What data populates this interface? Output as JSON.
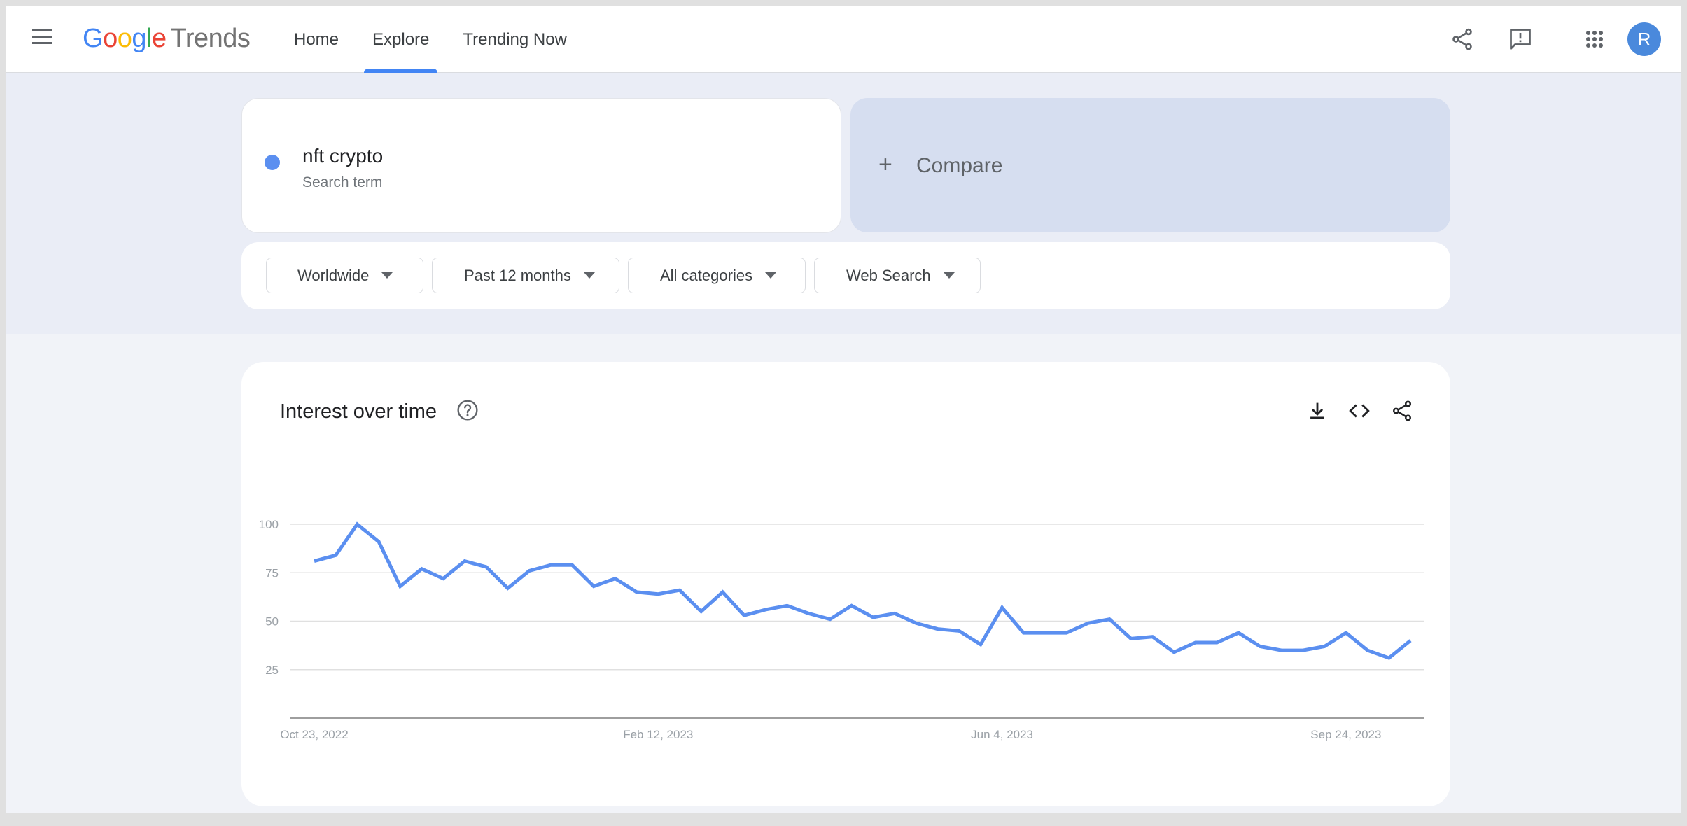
{
  "header": {
    "menu_icon": "hamburger-menu-icon",
    "logo": {
      "google": [
        "G",
        "o",
        "o",
        "g",
        "l",
        "e"
      ],
      "product": "Trends"
    },
    "nav": [
      {
        "label": "Home",
        "active": false
      },
      {
        "label": "Explore",
        "active": true
      },
      {
        "label": "Trending Now",
        "active": false
      }
    ],
    "icons": [
      "share-icon",
      "feedback-icon",
      "apps-grid-icon"
    ],
    "avatar_initial": "R",
    "accent_color": "#4285f4"
  },
  "search": {
    "term": "nft crypto",
    "term_subtitle": "Search term",
    "term_color": "#5b8ff0",
    "compare_label": "Compare",
    "compare_icon": "plus-icon"
  },
  "filters": [
    {
      "label": "Worldwide"
    },
    {
      "label": "Past 12 months"
    },
    {
      "label": "All categories"
    },
    {
      "label": "Web Search"
    }
  ],
  "chart_card": {
    "title": "Interest over time",
    "icons": [
      "help-icon",
      "download-icon",
      "embed-code-icon",
      "share-icon"
    ]
  },
  "chart_data": {
    "type": "line",
    "title": "Interest over time",
    "xlabel": "",
    "ylabel": "",
    "ylim": [
      0,
      100
    ],
    "yticks": [
      25,
      50,
      75,
      100
    ],
    "x_tick_labels": [
      {
        "index": 0,
        "label": "Oct 23, 2022"
      },
      {
        "index": 16,
        "label": "Feb 12, 2023"
      },
      {
        "index": 32,
        "label": "Jun 4, 2023"
      },
      {
        "index": 48,
        "label": "Sep 24, 2023"
      }
    ],
    "grid": true,
    "series": [
      {
        "name": "nft crypto",
        "color": "#5b8ff0",
        "values": [
          81,
          84,
          100,
          91,
          68,
          77,
          72,
          81,
          78,
          67,
          76,
          79,
          79,
          68,
          72,
          65,
          64,
          66,
          55,
          65,
          53,
          56,
          58,
          54,
          51,
          58,
          52,
          54,
          49,
          46,
          45,
          38,
          57,
          44,
          44,
          44,
          49,
          51,
          41,
          42,
          34,
          39,
          39,
          44,
          37,
          35,
          35,
          37,
          44,
          35,
          31,
          40
        ]
      }
    ]
  }
}
